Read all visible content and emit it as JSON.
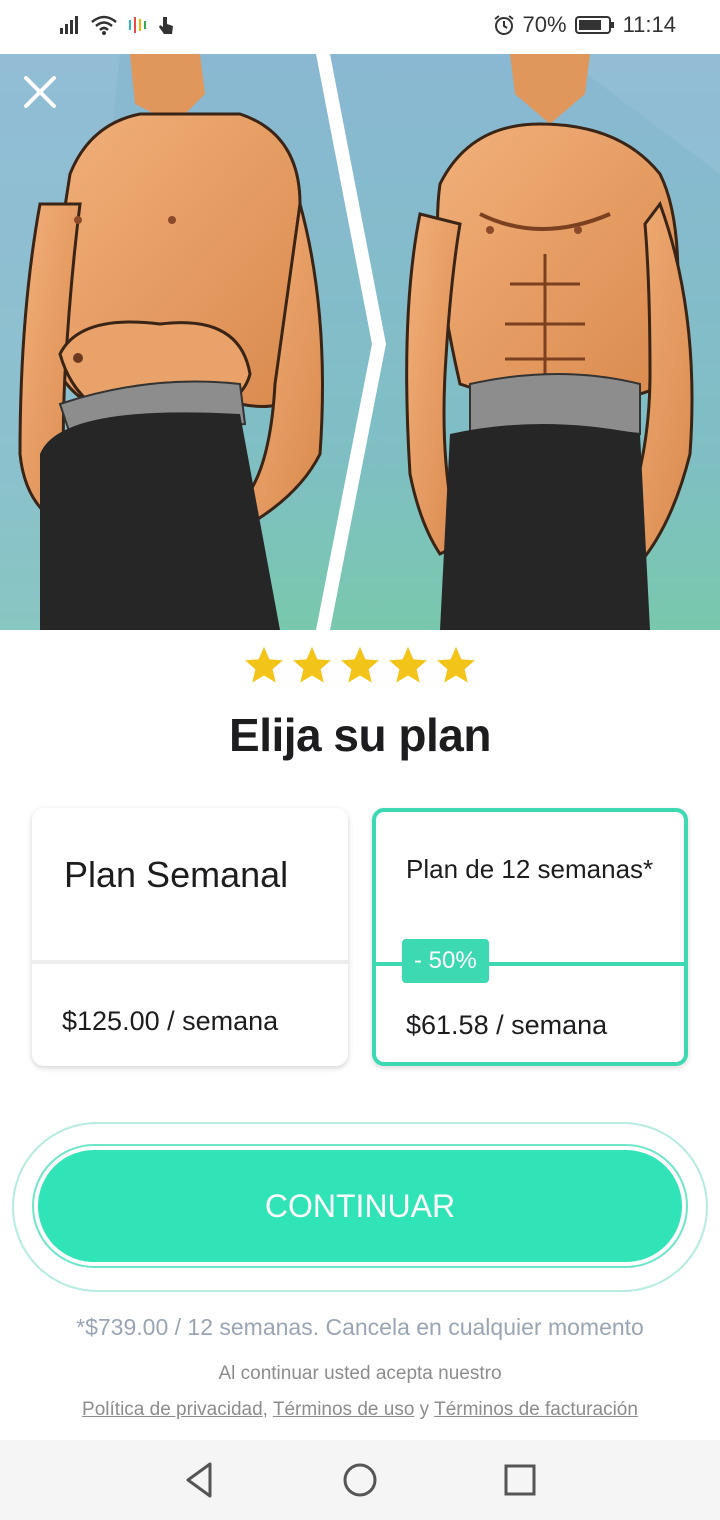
{
  "status_bar": {
    "battery": "70%",
    "time": "11:14"
  },
  "rating": {
    "stars": 5
  },
  "title": "Elija su plan",
  "plans": [
    {
      "name": "Plan Semanal",
      "price": "$125.00 / semana",
      "selected": false
    },
    {
      "name": "Plan de 12 semanas*",
      "price": "$61.58 / semana",
      "badge": "- 50%",
      "selected": true
    }
  ],
  "continue_label": "CONTINUAR",
  "footnote": "*$739.00 / 12 semanas. Cancela en cualquier momento",
  "legal": {
    "intro": "Al continuar usted acepta nuestro",
    "privacy": "Política de privacidad",
    "sep1": ",",
    "terms": "Términos de uso",
    "and": "y",
    "billing": "Términos de facturación"
  },
  "colors": {
    "accent": "#30e4b7",
    "card_border": "#3dd9b3",
    "star": "#f2c318",
    "hero_bg_top": "#8ab8d2",
    "hero_bg_bottom": "#7cc5b8"
  },
  "icons": {
    "close": "close-icon",
    "star": "star-icon",
    "back": "back-triangle-icon",
    "home": "home-circle-icon",
    "recents": "recents-square-icon"
  }
}
